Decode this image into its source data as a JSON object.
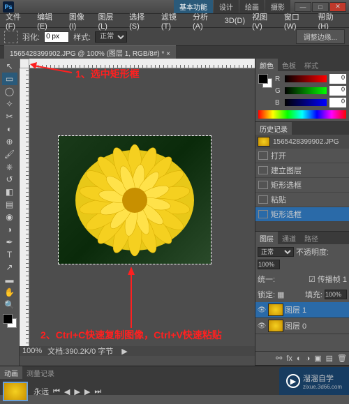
{
  "title_tabs": [
    "基本功能",
    "设计",
    "绘画",
    "摄影"
  ],
  "menu": [
    "文件(F)",
    "编辑(E)",
    "图像(I)",
    "图层(L)",
    "选择(S)",
    "滤镜(T)",
    "分析(A)",
    "3D(D)",
    "视图(V)",
    "窗口(W)",
    "帮助(H)"
  ],
  "options": {
    "feather_label": "羽化:",
    "feather_value": "0 px",
    "style_label": "样式:",
    "style_value": "正常",
    "adjust_btn": "调整边缘..."
  },
  "doc_tab": "1565428399902.JPG @ 100% (图层 1, RGB/8#) * ×",
  "annotations": {
    "a1": "1、选中矩形框",
    "a2": "2、Ctrl+C快速复制图像，Ctrl+V快速粘贴"
  },
  "status": {
    "zoom": "100%",
    "doc": "文档:390.2K/0 字节"
  },
  "color_panel": {
    "tabs": [
      "颜色",
      "色板",
      "样式"
    ],
    "r": "0",
    "g": "0",
    "b": "0"
  },
  "history_panel": {
    "tabs": [
      "历史记录"
    ],
    "file": "1565428399902.JPG",
    "items": [
      "打开",
      "建立图层",
      "矩形选框",
      "粘贴",
      "矩形选框"
    ]
  },
  "layers_panel": {
    "tabs": [
      "图层",
      "通道",
      "路径"
    ],
    "blend": "正常",
    "opacity_label": "不透明度:",
    "opacity": "100%",
    "lock_label": "锁定:",
    "fill_label": "填充:",
    "fill": "100%",
    "unify_label": "统一:",
    "propagate": "传播帧 1",
    "layers": [
      {
        "name": "图层 1"
      },
      {
        "name": "图层 0"
      }
    ]
  },
  "bottom_tabs": [
    "动画",
    "测量记录"
  ],
  "bottom_label": "永远",
  "watermark": {
    "brand": "溜溜自学",
    "url": "zixue.3d66.com"
  }
}
